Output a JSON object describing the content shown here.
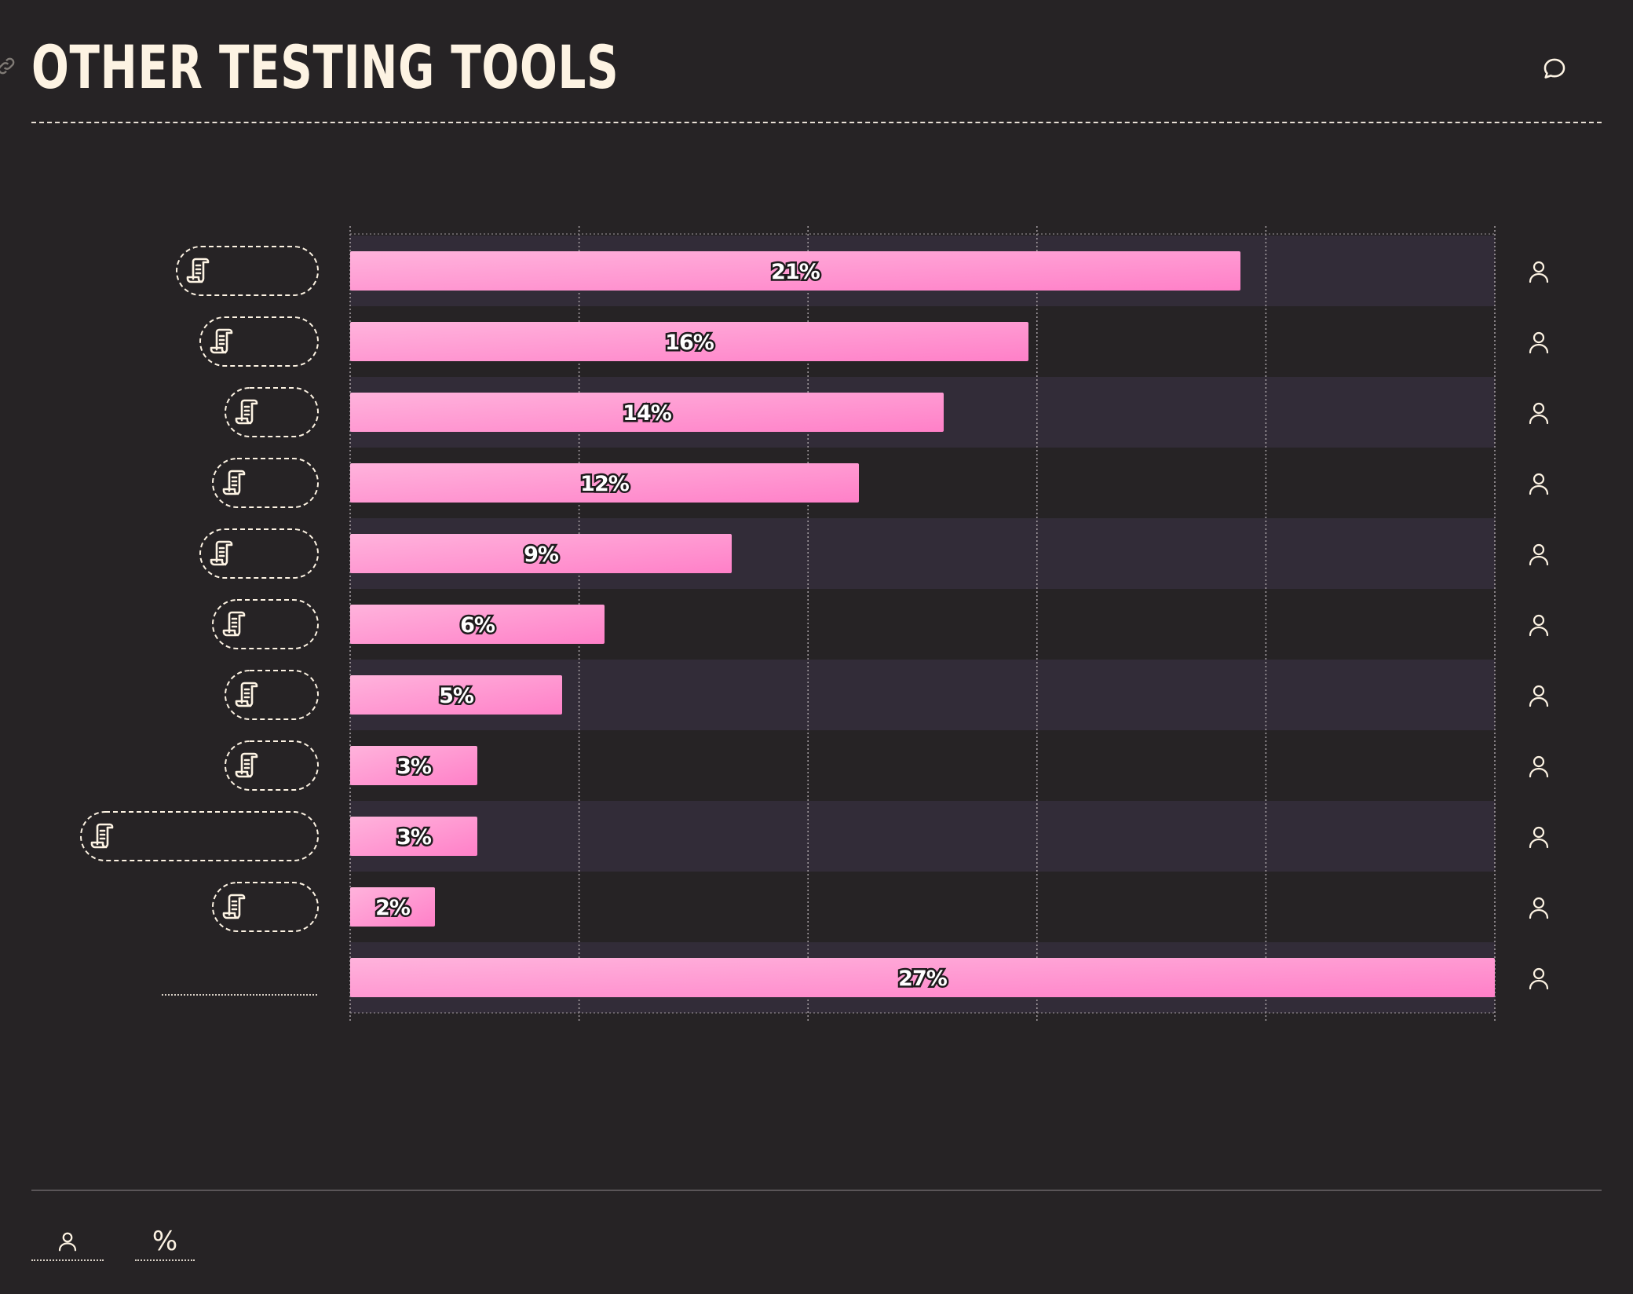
{
  "header": {
    "title": "Other Testing Tools",
    "link_icon": "link-icon",
    "comment_icon": "comment-icon"
  },
  "colors": {
    "background": "#262325",
    "bar_gradient_start": "#ffb3dc",
    "bar_gradient_end": "#ff80c8",
    "band_alternate": "#322c38",
    "text_light": "#fdf3e3"
  },
  "chart_data": {
    "type": "bar",
    "orientation": "horizontal",
    "title": "Other Testing Tools",
    "values": [
      21,
      16,
      14,
      12,
      9,
      6,
      5,
      3,
      3,
      2,
      27
    ],
    "labels": [
      "21%",
      "16%",
      "14%",
      "12%",
      "9%",
      "6%",
      "5%",
      "3%",
      "3%",
      "2%",
      "27%"
    ],
    "row_label_icon": "scroll-icon",
    "row_end_icon": "user-icon",
    "xlim": [
      0,
      27
    ],
    "gridlines": 5,
    "grid": true
  },
  "footer": {
    "respondents_icon": "user-icon",
    "percent_label": "%"
  }
}
